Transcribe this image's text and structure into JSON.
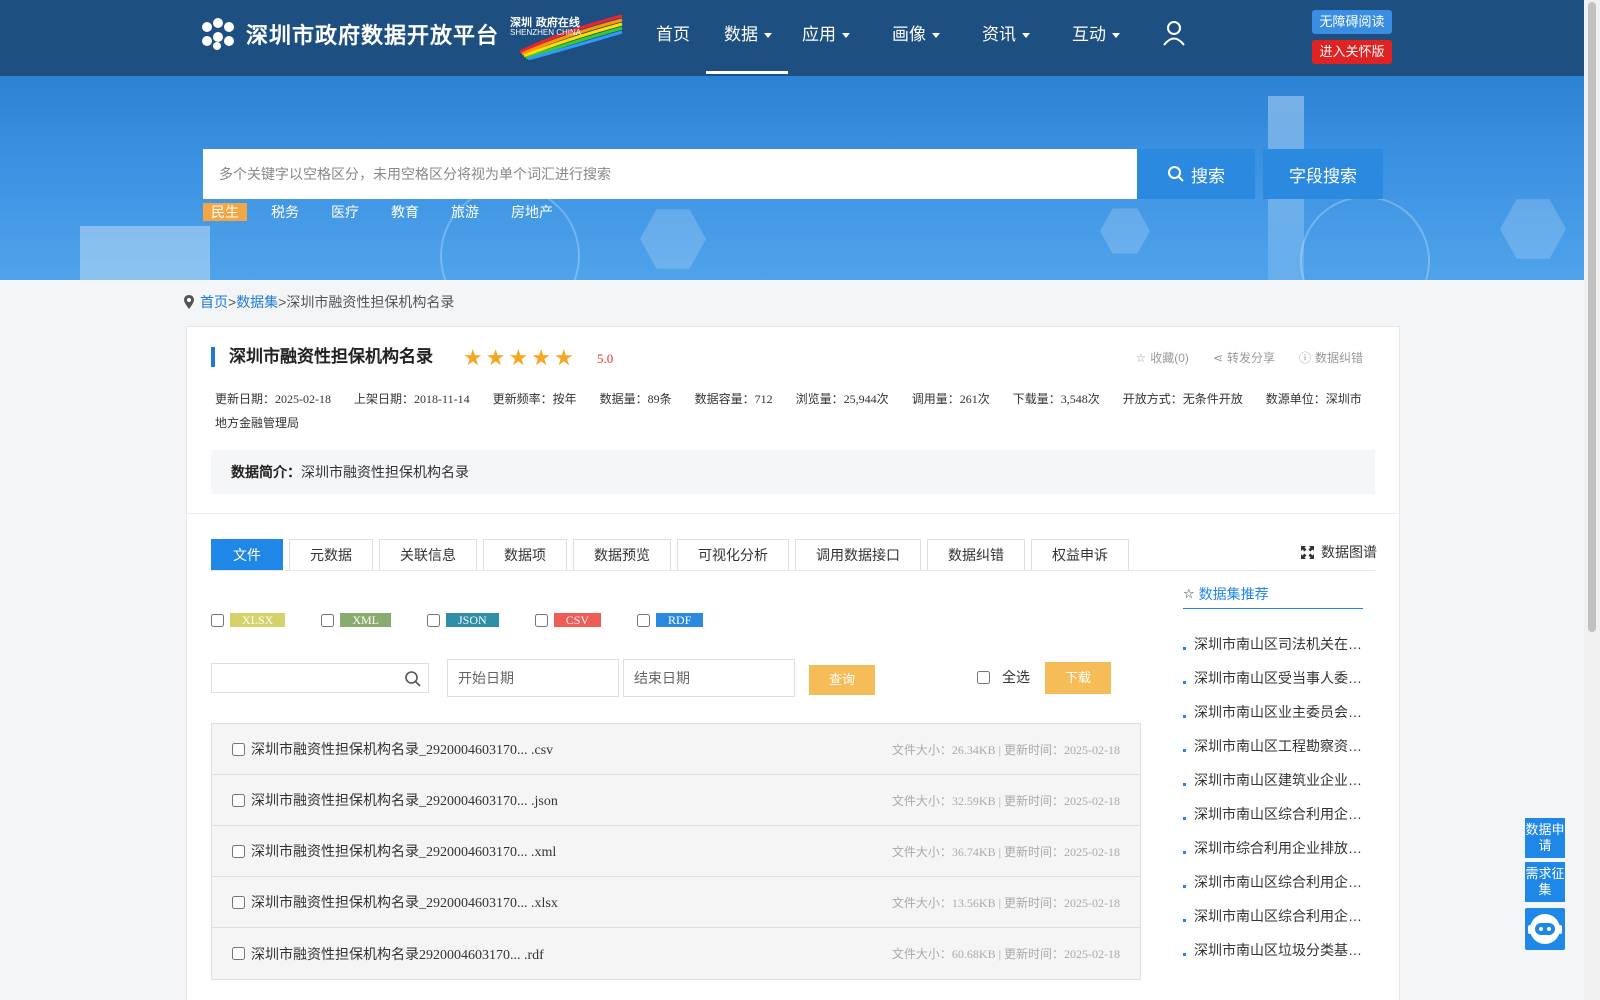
{
  "header": {
    "site_title": "深圳市政府数据开放平台",
    "badge_text_top": "深圳 政府在线",
    "badge_text_bottom": "SHENZHEN CHINA",
    "nav": [
      {
        "label": "首页",
        "dropdown": false,
        "active": false
      },
      {
        "label": "数据",
        "dropdown": true,
        "active": true
      },
      {
        "label": "应用",
        "dropdown": true,
        "active": false
      },
      {
        "label": "画像",
        "dropdown": true,
        "active": false
      },
      {
        "label": "资讯",
        "dropdown": true,
        "active": false
      },
      {
        "label": "互动",
        "dropdown": true,
        "active": false
      }
    ],
    "accessibility_label": "无障碍阅读",
    "care_mode_label": "进入关怀版"
  },
  "banner": {
    "search_placeholder": "多个关键字以空格区分，未用空格区分将视为单个词汇进行搜索",
    "search_button": "搜索",
    "field_search_button": "字段搜索",
    "tags": [
      "民生",
      "税务",
      "医疗",
      "教育",
      "旅游",
      "房地产"
    ],
    "active_tag": "民生"
  },
  "breadcrumb": {
    "home": "首页",
    "sep": ">",
    "datasets": "数据集",
    "current": "深圳市融资性担保机构名录"
  },
  "dataset": {
    "title": "深圳市融资性担保机构名录",
    "rating": 5,
    "score": "5.0",
    "favorite": "收藏(0)",
    "share": "转发分享",
    "report_error": "数据纠错",
    "meta": [
      {
        "key": "更新日期：",
        "value": "2025-02-18"
      },
      {
        "key": "上架日期：",
        "value": "2018-11-14"
      },
      {
        "key": "更新频率：",
        "value": "按年"
      },
      {
        "key": "数据量：",
        "value": "89条"
      },
      {
        "key": "数据容量：",
        "value": "712"
      },
      {
        "key": "浏览量：",
        "value": "25,944次"
      },
      {
        "key": "调用量：",
        "value": "261次"
      },
      {
        "key": "下载量：",
        "value": "3,548次"
      },
      {
        "key": "开放方式：",
        "value": "无条件开放"
      },
      {
        "key": "数源单位：",
        "value": "深圳市地方金融管理局"
      }
    ],
    "intro_label": "数据简介：",
    "intro_text": "深圳市融资性担保机构名录"
  },
  "tabs": [
    "文件",
    "元数据",
    "关联信息",
    "数据项",
    "数据预览",
    "可视化分析",
    "调用数据接口",
    "数据纠错",
    "权益申诉"
  ],
  "active_tab": "文件",
  "data_map_label": "数据图谱",
  "formats": [
    {
      "label": "XLSX",
      "color": "#d4d36a"
    },
    {
      "label": "XML",
      "color": "#8aab6e"
    },
    {
      "label": "JSON",
      "color": "#2e8fa6"
    },
    {
      "label": "CSV",
      "color": "#ef5b55"
    },
    {
      "label": "RDF",
      "color": "#2b8ae0"
    }
  ],
  "filters": {
    "start_date_placeholder": "开始日期",
    "end_date_placeholder": "结束日期",
    "query_button": "查询",
    "select_all": "全选",
    "download_button": "下载"
  },
  "files": [
    {
      "name": "深圳市融资性担保机构名录_2920004603170... .csv",
      "size": "文件大小：26.34KB",
      "updated": "更新时间：2025-02-18"
    },
    {
      "name": "深圳市融资性担保机构名录_2920004603170... .json",
      "size": "文件大小：32.59KB",
      "updated": "更新时间：2025-02-18"
    },
    {
      "name": "深圳市融资性担保机构名录_2920004603170... .xml",
      "size": "文件大小：36.74KB",
      "updated": "更新时间：2025-02-18"
    },
    {
      "name": "深圳市融资性担保机构名录_2920004603170... .xlsx",
      "size": "文件大小：13.56KB",
      "updated": "更新时间：2025-02-18"
    },
    {
      "name": "深圳市融资性担保机构名录2920004603170... .rdf",
      "size": "文件大小：60.68KB",
      "updated": "更新时间：2025-02-18"
    }
  ],
  "recommend": {
    "title": "数据集推荐",
    "items": [
      "深圳市南山区司法机关在…",
      "深圳市南山区受当事人委…",
      "深圳市南山区业主委员会…",
      "深圳市南山区工程勘察资…",
      "深圳市南山区建筑业企业…",
      "深圳市南山区综合利用企…",
      "深圳市综合利用企业排放…",
      "深圳市南山区综合利用企…",
      "深圳市南山区综合利用企…",
      "深圳市南山区垃圾分类基…"
    ]
  },
  "floating": {
    "data_apply": "数据申请",
    "demand_collect": "需求征集",
    "robot_icon": "robot-icon"
  },
  "colors": {
    "nav_bg": "#1d4f80",
    "accent": "#1f87e8",
    "tag_active": "#f3a744",
    "button_orange": "#f5bc58",
    "care_red": "#e02222"
  }
}
